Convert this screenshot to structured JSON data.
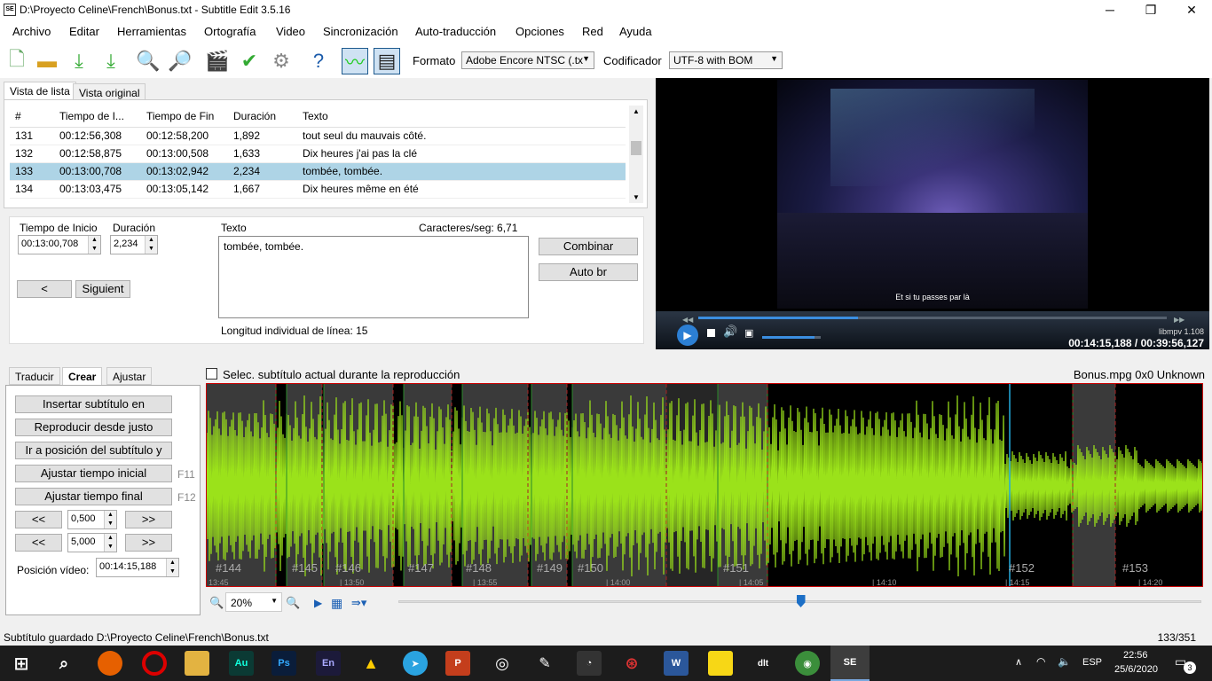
{
  "window": {
    "title": "D:\\Proyecto Celine\\French\\Bonus.txt - Subtitle Edit 3.5.16",
    "app_icon": "SE",
    "minimize": "─",
    "maximize": "❐",
    "close": "✕"
  },
  "menu": [
    "Archivo",
    "Editar",
    "Herramientas",
    "Ortografía",
    "Video",
    "Sincronización",
    "Auto-traducción",
    "Opciones",
    "Red",
    "Ayuda"
  ],
  "toolbar": {
    "format_label": "Formato",
    "format_value": "Adobe Encore NTSC (.tx",
    "encoding_label": "Codificador",
    "encoding_value": "UTF-8 with BOM"
  },
  "tabs": {
    "list": "Vista de lista",
    "original": "Vista original"
  },
  "list": {
    "headers": [
      "#",
      "Tiempo de I...",
      "Tiempo de Fin",
      "Duración",
      "Texto"
    ],
    "rows": [
      [
        "131",
        "00:12:56,308",
        "00:12:58,200",
        "1,892",
        "tout seul du mauvais côté."
      ],
      [
        "132",
        "00:12:58,875",
        "00:13:00,508",
        "1,633",
        "Dix heures j'ai pas la clé"
      ],
      [
        "133",
        "00:13:00,708",
        "00:13:02,942",
        "2,234",
        "tombée, tombée."
      ],
      [
        "134",
        "00:13:03,475",
        "00:13:05,142",
        "1,667",
        "Dix heures même en été"
      ]
    ]
  },
  "editor": {
    "start_label": "Tiempo de Inicio",
    "start_value": "00:13:00,708",
    "duration_label": "Duración",
    "duration_value": "2,234",
    "text_label": "Texto",
    "cps_label": "Caracteres/seg: 6,71",
    "text_value": "tombée, tombée.",
    "prev": "<",
    "next": "Siguient",
    "combine": "Combinar",
    "autobr": "Auto br",
    "line_length": "Longitud individual de línea: 15"
  },
  "video": {
    "subtitle": "Et si tu passes par là",
    "player": "libmpv 1.108",
    "time": "00:14:15,188 / 00:39:56,127",
    "progress": 0.34,
    "volume": 0.9
  },
  "bottom_tabs": [
    "Traducir",
    "Crear",
    "Ajustar"
  ],
  "create": {
    "insert": "Insertar subtítulo en",
    "play_from": "Reproducir desde justo",
    "goto": "Ir a posición del subtítulo y",
    "set_start": "Ajustar tiempo inicial",
    "set_start_key": "F11",
    "set_end": "Ajustar tiempo final",
    "set_end_key": "F12",
    "back": "<<",
    "fwd": ">>",
    "step1": "0,500",
    "step2": "5,000",
    "pos_label": "Posición vídeo:",
    "pos_value": "00:14:15,188"
  },
  "waveform": {
    "checkbox_label": "Selec. subtítulo actual durante la reproducción",
    "file_info": "Bonus.mpg 0x0 Unknown",
    "zoom": "20%",
    "labels": [
      "#144",
      "#145",
      "#146",
      "#147",
      "#148",
      "#149",
      "#150",
      "#151",
      "#152",
      "#153"
    ],
    "times": [
      "13:45",
      "13:50",
      "13:55",
      "14:00",
      "14:05",
      "14:10",
      "14:15",
      "14:20"
    ],
    "slider": 0.5
  },
  "status": {
    "left": "Subtítulo guardado D:\\Proyecto Celine\\French\\Bonus.txt",
    "right": "133/351"
  },
  "taskbar": {
    "lang": "ESP",
    "time": "22:56",
    "date": "25/6/2020",
    "notif": "3"
  }
}
